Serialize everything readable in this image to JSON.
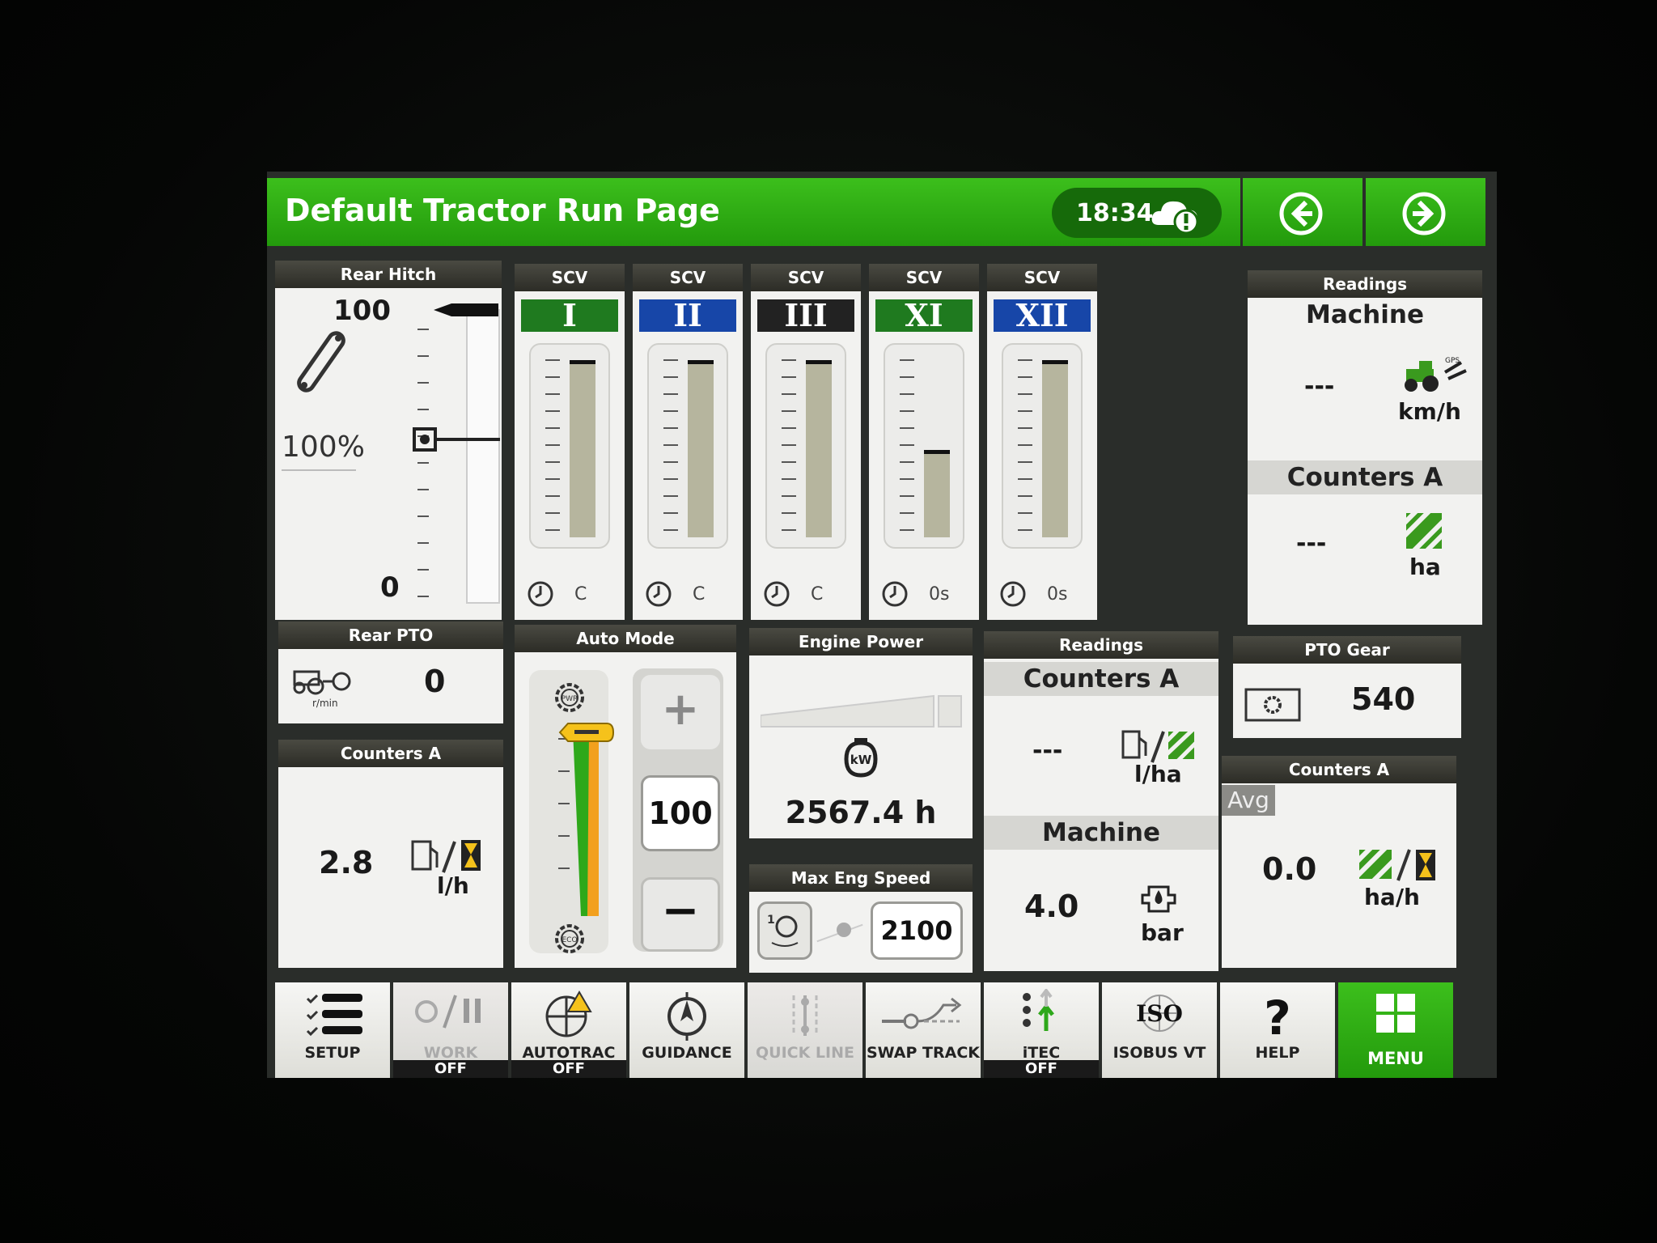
{
  "header": {
    "title": "Default Tractor Run Page",
    "time": "18:34"
  },
  "rear_hitch": {
    "title": "Rear Hitch",
    "max_label": "100",
    "min_label": "0",
    "percent": "100%",
    "position_fraction": 0.55
  },
  "scv": [
    {
      "title": "SCV",
      "label": "I",
      "color": "#1f7a1f",
      "fill": 1.0,
      "foot": "C"
    },
    {
      "title": "SCV",
      "label": "II",
      "color": "#1746a8",
      "fill": 1.0,
      "foot": "C"
    },
    {
      "title": "SCV",
      "label": "III",
      "color": "#222222",
      "fill": 1.0,
      "foot": "C"
    },
    {
      "title": "SCV",
      "label": "XI",
      "color": "#1f7a1f",
      "fill": 0.48,
      "foot": "0s"
    },
    {
      "title": "SCV",
      "label": "XII",
      "color": "#1746a8",
      "fill": 1.0,
      "foot": "0s"
    }
  ],
  "readings_top": {
    "title": "Readings",
    "sub1": "Machine",
    "value1": "---",
    "unit1": "km/h",
    "sub2": "Counters A",
    "value2": "---",
    "unit2": "ha"
  },
  "rear_pto": {
    "title": "Rear PTO",
    "value": "0",
    "unit": "r/min"
  },
  "counters_left": {
    "title": "Counters A",
    "value": "2.8",
    "unit": "l/h"
  },
  "auto_mode": {
    "title": "Auto Mode",
    "plus": "+",
    "value": "100",
    "minus": "−",
    "top_icon": "PWR",
    "bottom_icon": "ECO"
  },
  "engine_power": {
    "title": "Engine Power",
    "value": "2567.4 h",
    "icon": "kW"
  },
  "max_eng_speed": {
    "title": "Max Eng Speed",
    "value": "2100"
  },
  "readings_mid": {
    "title": "Readings",
    "sub1": "Counters A",
    "value1": "---",
    "unit1": "l/ha",
    "sub2": "Machine",
    "value2": "4.0",
    "unit2": "bar"
  },
  "pto_gear": {
    "title": "PTO Gear",
    "value": "540"
  },
  "counters_right": {
    "title": "Counters A",
    "avg": "Avg",
    "value": "0.0",
    "unit": "ha/h"
  },
  "toolbar": [
    {
      "label": "SETUP",
      "state": ""
    },
    {
      "label": "WORK",
      "state": "OFF"
    },
    {
      "label": "AUTOTRAC",
      "state": "OFF"
    },
    {
      "label": "GUIDANCE",
      "state": ""
    },
    {
      "label": "QUICK LINE",
      "state": ""
    },
    {
      "label": "SWAP TRACK",
      "state": ""
    },
    {
      "label": "iTEC",
      "state": "OFF"
    },
    {
      "label": "ISOBUS VT",
      "state": ""
    },
    {
      "label": "HELP",
      "state": ""
    },
    {
      "label": "MENU",
      "state": ""
    }
  ],
  "colors": {
    "accent_green": "#2fae16",
    "title_bar": "#3a3a33",
    "green_bar": "#2ea81a",
    "orange_bar": "#f2a01e"
  }
}
